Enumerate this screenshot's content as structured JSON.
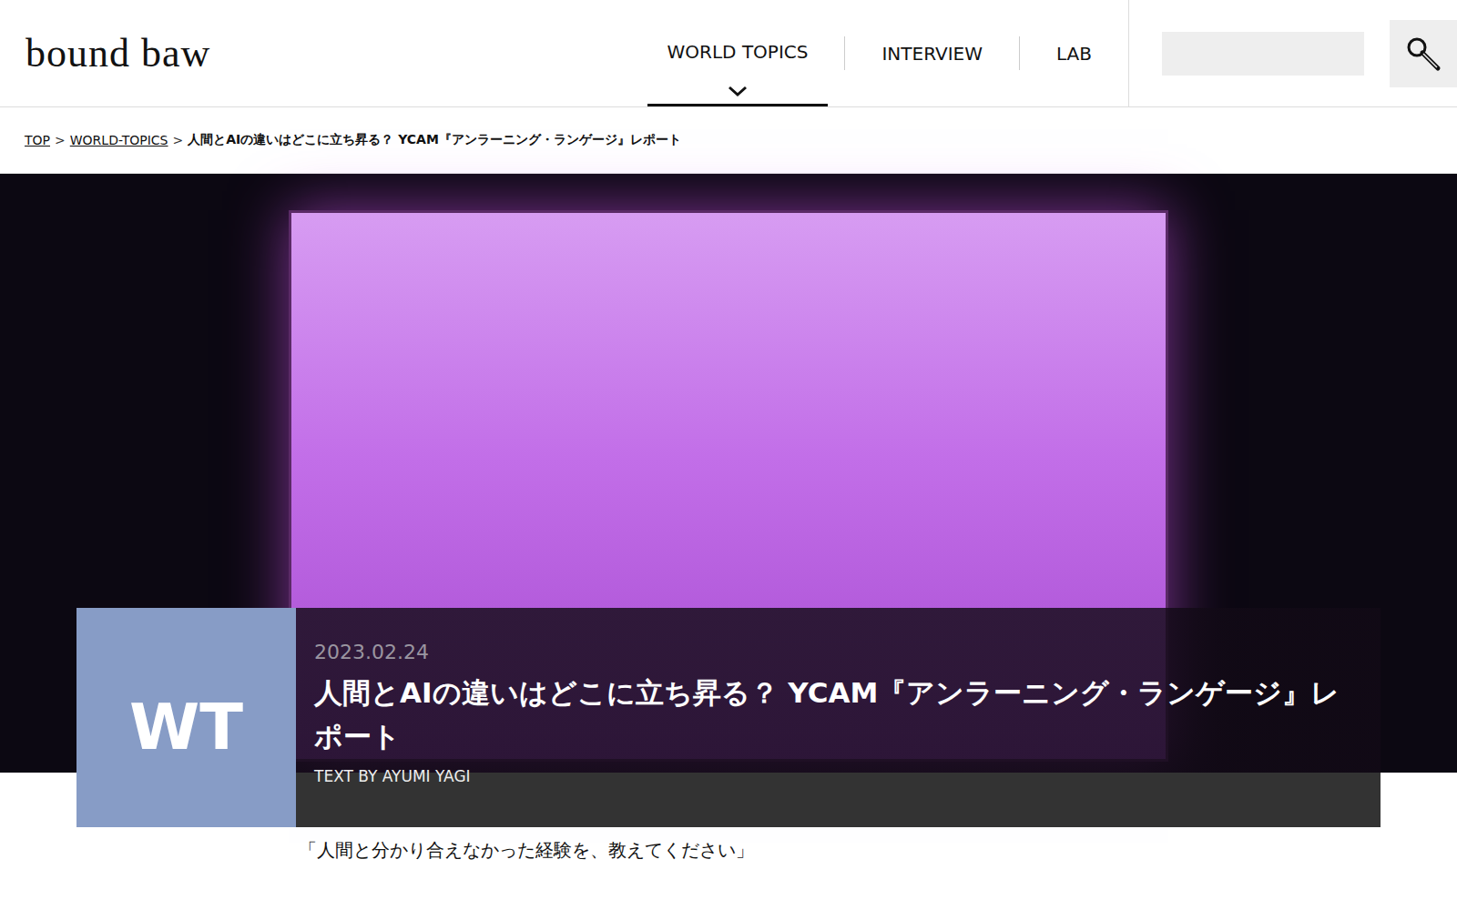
{
  "logo": "bound baw",
  "nav": [
    {
      "label": "WORLD TOPICS",
      "selected": true
    },
    {
      "label": "INTERVIEW",
      "selected": false
    },
    {
      "label": "LAB",
      "selected": false
    }
  ],
  "breadcrumb": {
    "separator": ">",
    "items": [
      {
        "label": "TOP",
        "link": true
      },
      {
        "label": "WORLD-TOPICS",
        "link": true
      },
      {
        "label": "人間とAIの違いはどこに立ち昇る？ YCAM『アンラーニング・ランゲージ』レポート",
        "link": false
      }
    ]
  },
  "article": {
    "category": "WT",
    "date": "2023.02.24",
    "title": "人間とAIの違いはどこに立ち昇る？ YCAM『アンラーニング・ランゲージ』レポート",
    "byline": "TEXT BY AYUMI YAGI",
    "lead": "「人間と分かり合えなかった経験を、教えてください」"
  }
}
